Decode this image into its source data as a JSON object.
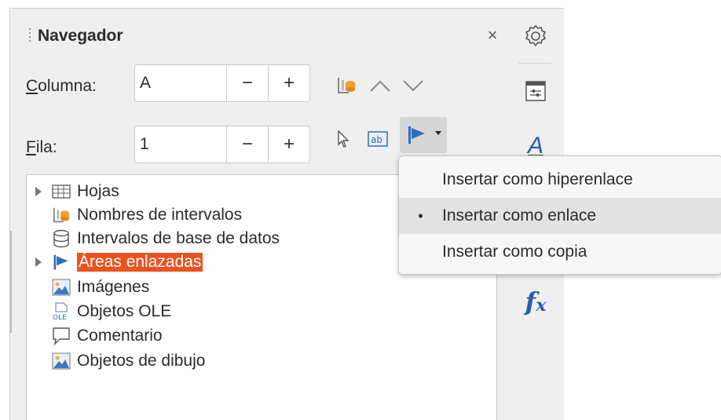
{
  "navigator": {
    "title": "Navegador",
    "close_label": "×",
    "columna_label_prefix": "C",
    "columna_label_rest": "olumna:",
    "columna_value": "A",
    "fila_label_prefix": "F",
    "fila_label_rest": "ila:",
    "fila_value": "1",
    "minus": "−",
    "plus": "+"
  },
  "tree": {
    "items": [
      {
        "label": "Hojas",
        "icon": "grid-icon",
        "expandable": true
      },
      {
        "label": "Nombres de intervalos",
        "icon": "range-names-icon",
        "expandable": false
      },
      {
        "label": "Intervalos de base de datos",
        "icon": "database-icon",
        "expandable": false
      },
      {
        "label": "Áreas enlazadas",
        "icon": "flag-icon",
        "expandable": true,
        "selected": true
      },
      {
        "label": "Imágenes",
        "icon": "image-icon",
        "expandable": false
      },
      {
        "label": "Objetos OLE",
        "icon": "ole-icon",
        "expandable": false
      },
      {
        "label": "Comentario",
        "icon": "comment-icon",
        "expandable": false
      },
      {
        "label": "Objetos de dibujo",
        "icon": "image-icon",
        "expandable": false
      }
    ]
  },
  "ole_icon_text": "OLE",
  "menu": {
    "items": [
      {
        "label": "Insertar como hiperenlace",
        "selected": false
      },
      {
        "label": "Insertar como enlace",
        "selected": true
      },
      {
        "label": "Insertar como copia",
        "selected": false
      }
    ],
    "bullet": "•"
  },
  "sidebar": {
    "icons": [
      "gear-icon",
      "properties-icon",
      "styles-icon",
      "function-icon"
    ],
    "styles_glyph": "A",
    "function_glyph_f": "f",
    "function_glyph_x": "x"
  },
  "colors": {
    "accent": "#e9531f",
    "flag_blue": "#2a6fc1",
    "function_blue": "#2a5db0"
  }
}
